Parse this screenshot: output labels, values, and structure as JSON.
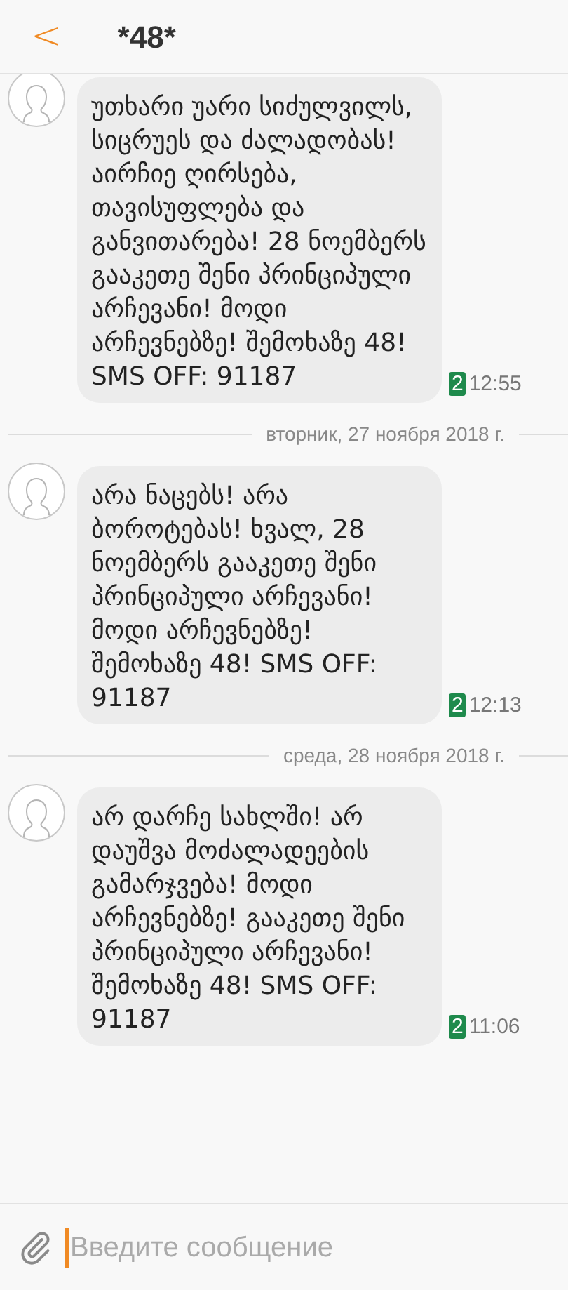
{
  "header": {
    "back": "<",
    "title": "*48*"
  },
  "items": [
    {
      "kind": "message",
      "text": "უთხარი უარი სიძულვილს, სიცრუეს და ძალადობას! აირჩიე ღირსება, თავისუფლება და განვითარება! 28 ნოემბერს გააკეთე შენი პრინციპული არჩევანი! მოდი არჩევნებზე! შემოხაზე 48! SMS OFF: 91187",
      "sim": "2",
      "time": "12:55"
    },
    {
      "kind": "date",
      "text": "вторник, 27 ноября 2018 г."
    },
    {
      "kind": "message",
      "text": "არა ნაცებს! არა ბოროტებას! ხვალ, 28 ნოემბერს გააკეთე შენი პრინციპული არჩევანი! მოდი არჩევნებზე! შემოხაზე 48! SMS OFF: 91187",
      "sim": "2",
      "time": "12:13"
    },
    {
      "kind": "date",
      "text": "среда, 28 ноября 2018 г."
    },
    {
      "kind": "message",
      "text": "არ დარჩე სახლში! არ დაუშვა მოძალადეების გამარჯვება! მოდი არჩევნებზე! გააკეთე შენი პრინციპული არჩევანი! შემოხაზე 48! SMS OFF: 91187",
      "sim": "2",
      "time": "11:06"
    }
  ],
  "composer": {
    "placeholder": "Введите сообщение"
  }
}
